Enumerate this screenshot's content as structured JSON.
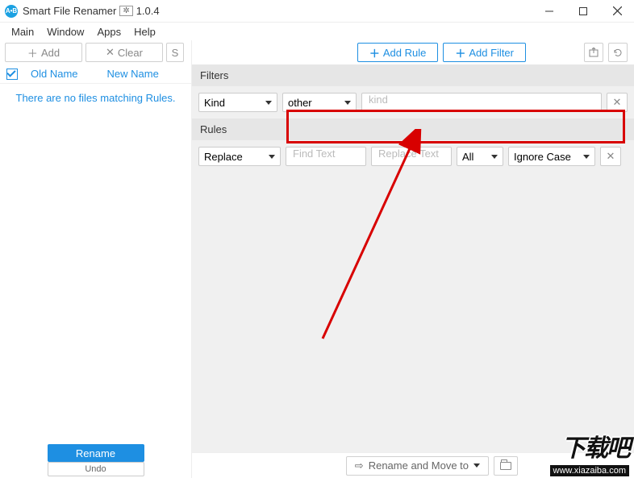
{
  "title": {
    "app_name": "Smart File Renamer",
    "version": "1.0.4"
  },
  "menu": {
    "items": [
      "Main",
      "Window",
      "Apps",
      "Help"
    ]
  },
  "left": {
    "add_label": "Add",
    "clear_label": "Clear",
    "sort_cut": "S",
    "col_old": "Old Name",
    "col_new": "New Name",
    "empty_msg": "There are no files matching Rules.",
    "rename_label": "Rename",
    "undo_label": "Undo"
  },
  "right": {
    "add_rule_label": "Add Rule",
    "add_filter_label": "Add Filter",
    "filters_header": "Filters",
    "rules_header": "Rules",
    "filter_row": {
      "kind_label": "Kind",
      "other_label": "other",
      "kind_placeholder": "kind"
    },
    "rule_row": {
      "replace_label": "Replace",
      "find_placeholder": "Find Text",
      "replace_placeholder": "Replace Text",
      "all_label": "All",
      "ignore_case_label": "Ignore Case"
    },
    "bottom": {
      "move_label": "Rename and Move to"
    }
  },
  "watermark": {
    "big": "下载吧",
    "url": "www.xiazaiba.com"
  }
}
